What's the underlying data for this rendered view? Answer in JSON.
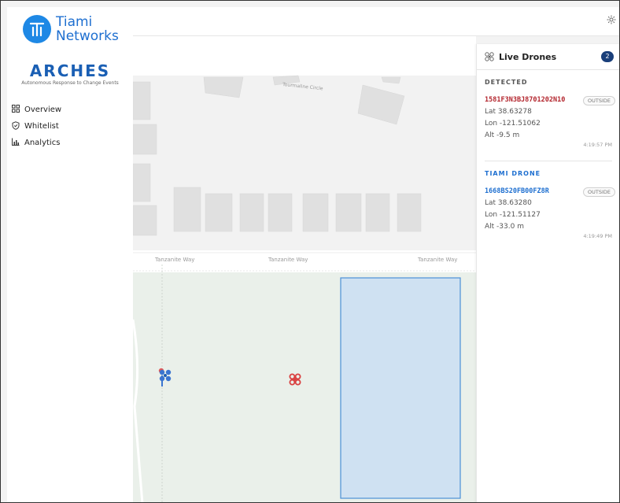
{
  "brand": {
    "logo_line1": "Tiami",
    "logo_line2": "Networks",
    "app_name": "ARCHES",
    "app_subtitle": "Autonomous Response to Change Events"
  },
  "sidebar": {
    "items": [
      {
        "label": "Overview",
        "icon": "grid-icon"
      },
      {
        "label": "Whitelist",
        "icon": "shield-icon"
      },
      {
        "label": "Analytics",
        "icon": "bar-chart-icon"
      }
    ]
  },
  "header": {
    "settings_icon": "gear-icon"
  },
  "map": {
    "street_labels": [
      "Tourmaline Circle",
      "Tanzanite Way",
      "Tanzanite Way",
      "Tanzanite Way"
    ],
    "zone_color": "#cfe1f2",
    "zone_border": "#4a8fd6"
  },
  "panel": {
    "title": "Live Drones",
    "count": "2",
    "sections": [
      {
        "label": "DETECTED",
        "drone_id": "1581F3N3BJ8701202N10",
        "status": "OUTSIDE",
        "lat": "Lat 38.63278",
        "lon": "Lon -121.51062",
        "alt": "Alt -9.5 m",
        "time": "4:19:57 PM",
        "color": "#b3262e"
      },
      {
        "label": "TIAMI DRONE",
        "drone_id": "1668BS20FB00FZ8R",
        "status": "OUTSIDE",
        "lat": "Lat 38.63280",
        "lon": "Lon -121.51127",
        "alt": "Alt -33.0 m",
        "time": "4:19:49 PM",
        "color": "#1e6fd0"
      }
    ]
  }
}
